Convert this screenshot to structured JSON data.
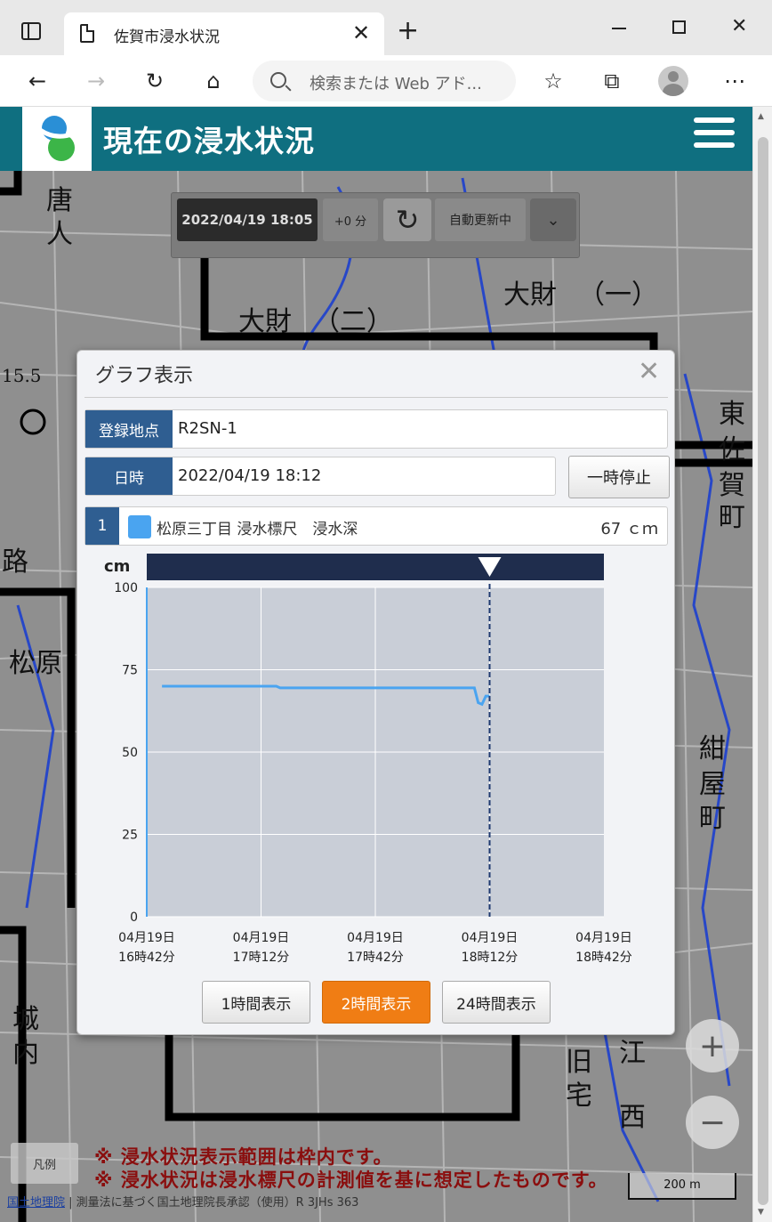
{
  "browser": {
    "tab_title": "佐賀市浸水状況",
    "address_placeholder": "検索または Web アド..."
  },
  "header": {
    "title": "現在の浸水状況"
  },
  "time_control": {
    "time": "2022/04/19 18:05",
    "offset": "+0 分",
    "auto_update": "自動更新中"
  },
  "map_labels": [
    "唐",
    "人",
    "大財",
    "（一）",
    "大財",
    "（二）",
    "15.5",
    "路",
    "松原",
    "東",
    "佐",
    "賀",
    "町",
    "紺",
    "屋",
    "町",
    "城",
    "内",
    "旧",
    "宅",
    "江",
    "西"
  ],
  "dialog": {
    "title": "グラフ表示",
    "location_label": "登録地点",
    "location_value": "R2SN-1",
    "datetime_label": "日時",
    "datetime_value": "2022/04/19 18:12",
    "pause_label": "一時停止",
    "legend": {
      "number": "1",
      "name": "松原三丁目 浸水標尺　浸水深",
      "value": "67 ｃｍ",
      "color": "#4aa4f0"
    },
    "range_buttons": [
      {
        "label": "1時間表示",
        "active": false
      },
      {
        "label": "2時間表示",
        "active": true
      },
      {
        "label": "24時間表示",
        "active": false
      }
    ]
  },
  "chart_data": {
    "type": "line",
    "ylabel": "cm",
    "ylim": [
      0,
      100
    ],
    "yticks": [
      0,
      25,
      50,
      75,
      100
    ],
    "xticks": [
      "04月19日\n16時42分",
      "04月19日\n17時12分",
      "04月19日\n17時42分",
      "04月19日\n18時12分",
      "04月19日\n18時42分"
    ],
    "xlim_minutes": [
      0,
      120
    ],
    "current_marker_minute": 90,
    "series": [
      {
        "color": "#4aa4f0",
        "x_minutes": [
          4,
          34,
          35,
          86,
          87,
          88,
          89,
          90
        ],
        "values": [
          70,
          70,
          69.5,
          69.5,
          65,
          64.5,
          67,
          67
        ]
      }
    ],
    "grid": true,
    "background": "#c9ced7"
  },
  "notices": [
    "※ 浸水状況表示範囲は枠内です。",
    "※ 浸水状況は浸水標尺の計測値を基に想定したものです。"
  ],
  "legend_button": "凡例",
  "scale_label": "200 m",
  "attribution": {
    "link": "国土地理院",
    "text": " | 測量法に基づく国土地理院長承認（使用）R 3JHs 363"
  }
}
